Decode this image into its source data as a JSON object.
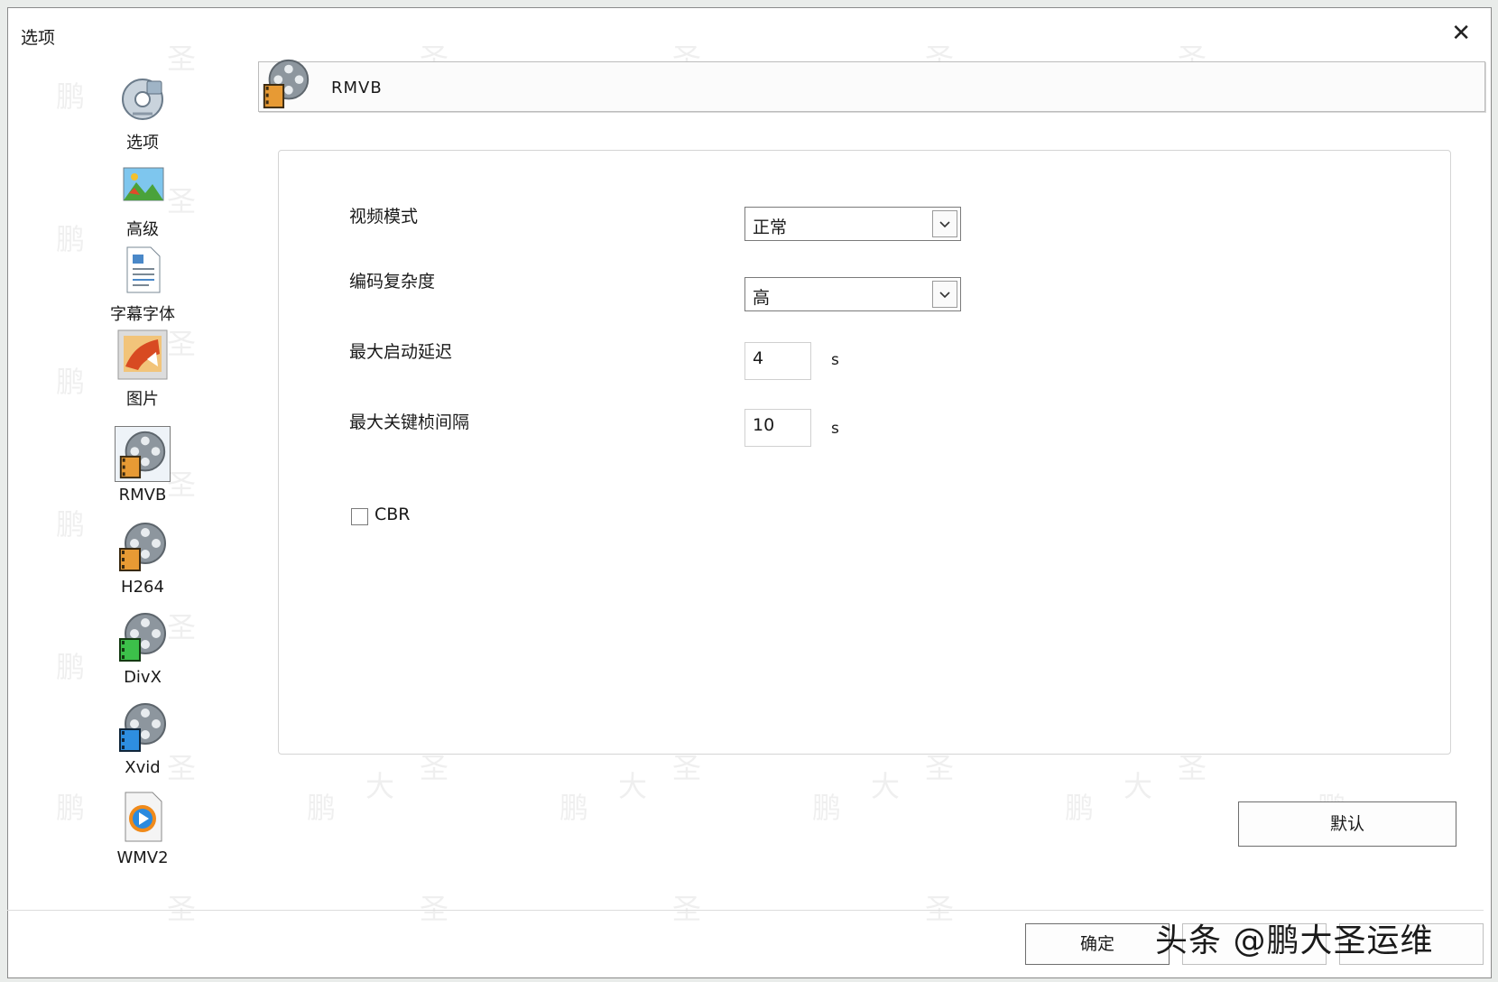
{
  "dialog": {
    "title": "选项",
    "close_glyph": "✕"
  },
  "sidebar": {
    "items": [
      {
        "label": "选项",
        "icon": "settings-disc-icon",
        "selected": false
      },
      {
        "label": "高级",
        "icon": "landscape-picture-icon",
        "selected": false
      },
      {
        "label": "字幕字体",
        "icon": "document-icon",
        "selected": false
      },
      {
        "label": "图片",
        "icon": "painting-icon",
        "selected": false
      },
      {
        "label": "RMVB",
        "icon": "film-reel-orange-icon",
        "selected": true
      },
      {
        "label": "H264",
        "icon": "film-reel-orange-icon",
        "selected": false
      },
      {
        "label": "DivX",
        "icon": "film-reel-green-icon",
        "selected": false
      },
      {
        "label": "Xvid",
        "icon": "film-reel-blue-icon",
        "selected": false
      },
      {
        "label": "WMV2",
        "icon": "media-player-icon",
        "selected": false
      }
    ]
  },
  "header": {
    "title": "RMVB",
    "icon": "film-reel-orange-icon"
  },
  "form": {
    "video_mode": {
      "label": "视频模式",
      "value": "正常"
    },
    "encode_complexity": {
      "label": "编码复杂度",
      "value": "高"
    },
    "max_start_delay": {
      "label": "最大启动延迟",
      "value": "4",
      "unit": "s"
    },
    "max_keyframe_interval": {
      "label": "最大关键桢间隔",
      "value": "10",
      "unit": "s"
    },
    "cbr": {
      "label": "CBR",
      "checked": false
    }
  },
  "buttons": {
    "default_label": "默认",
    "ok_label": "确定"
  },
  "credit": "头条 @鹏大圣运维",
  "watermark_chars": [
    "鹏",
    "大",
    "圣"
  ]
}
